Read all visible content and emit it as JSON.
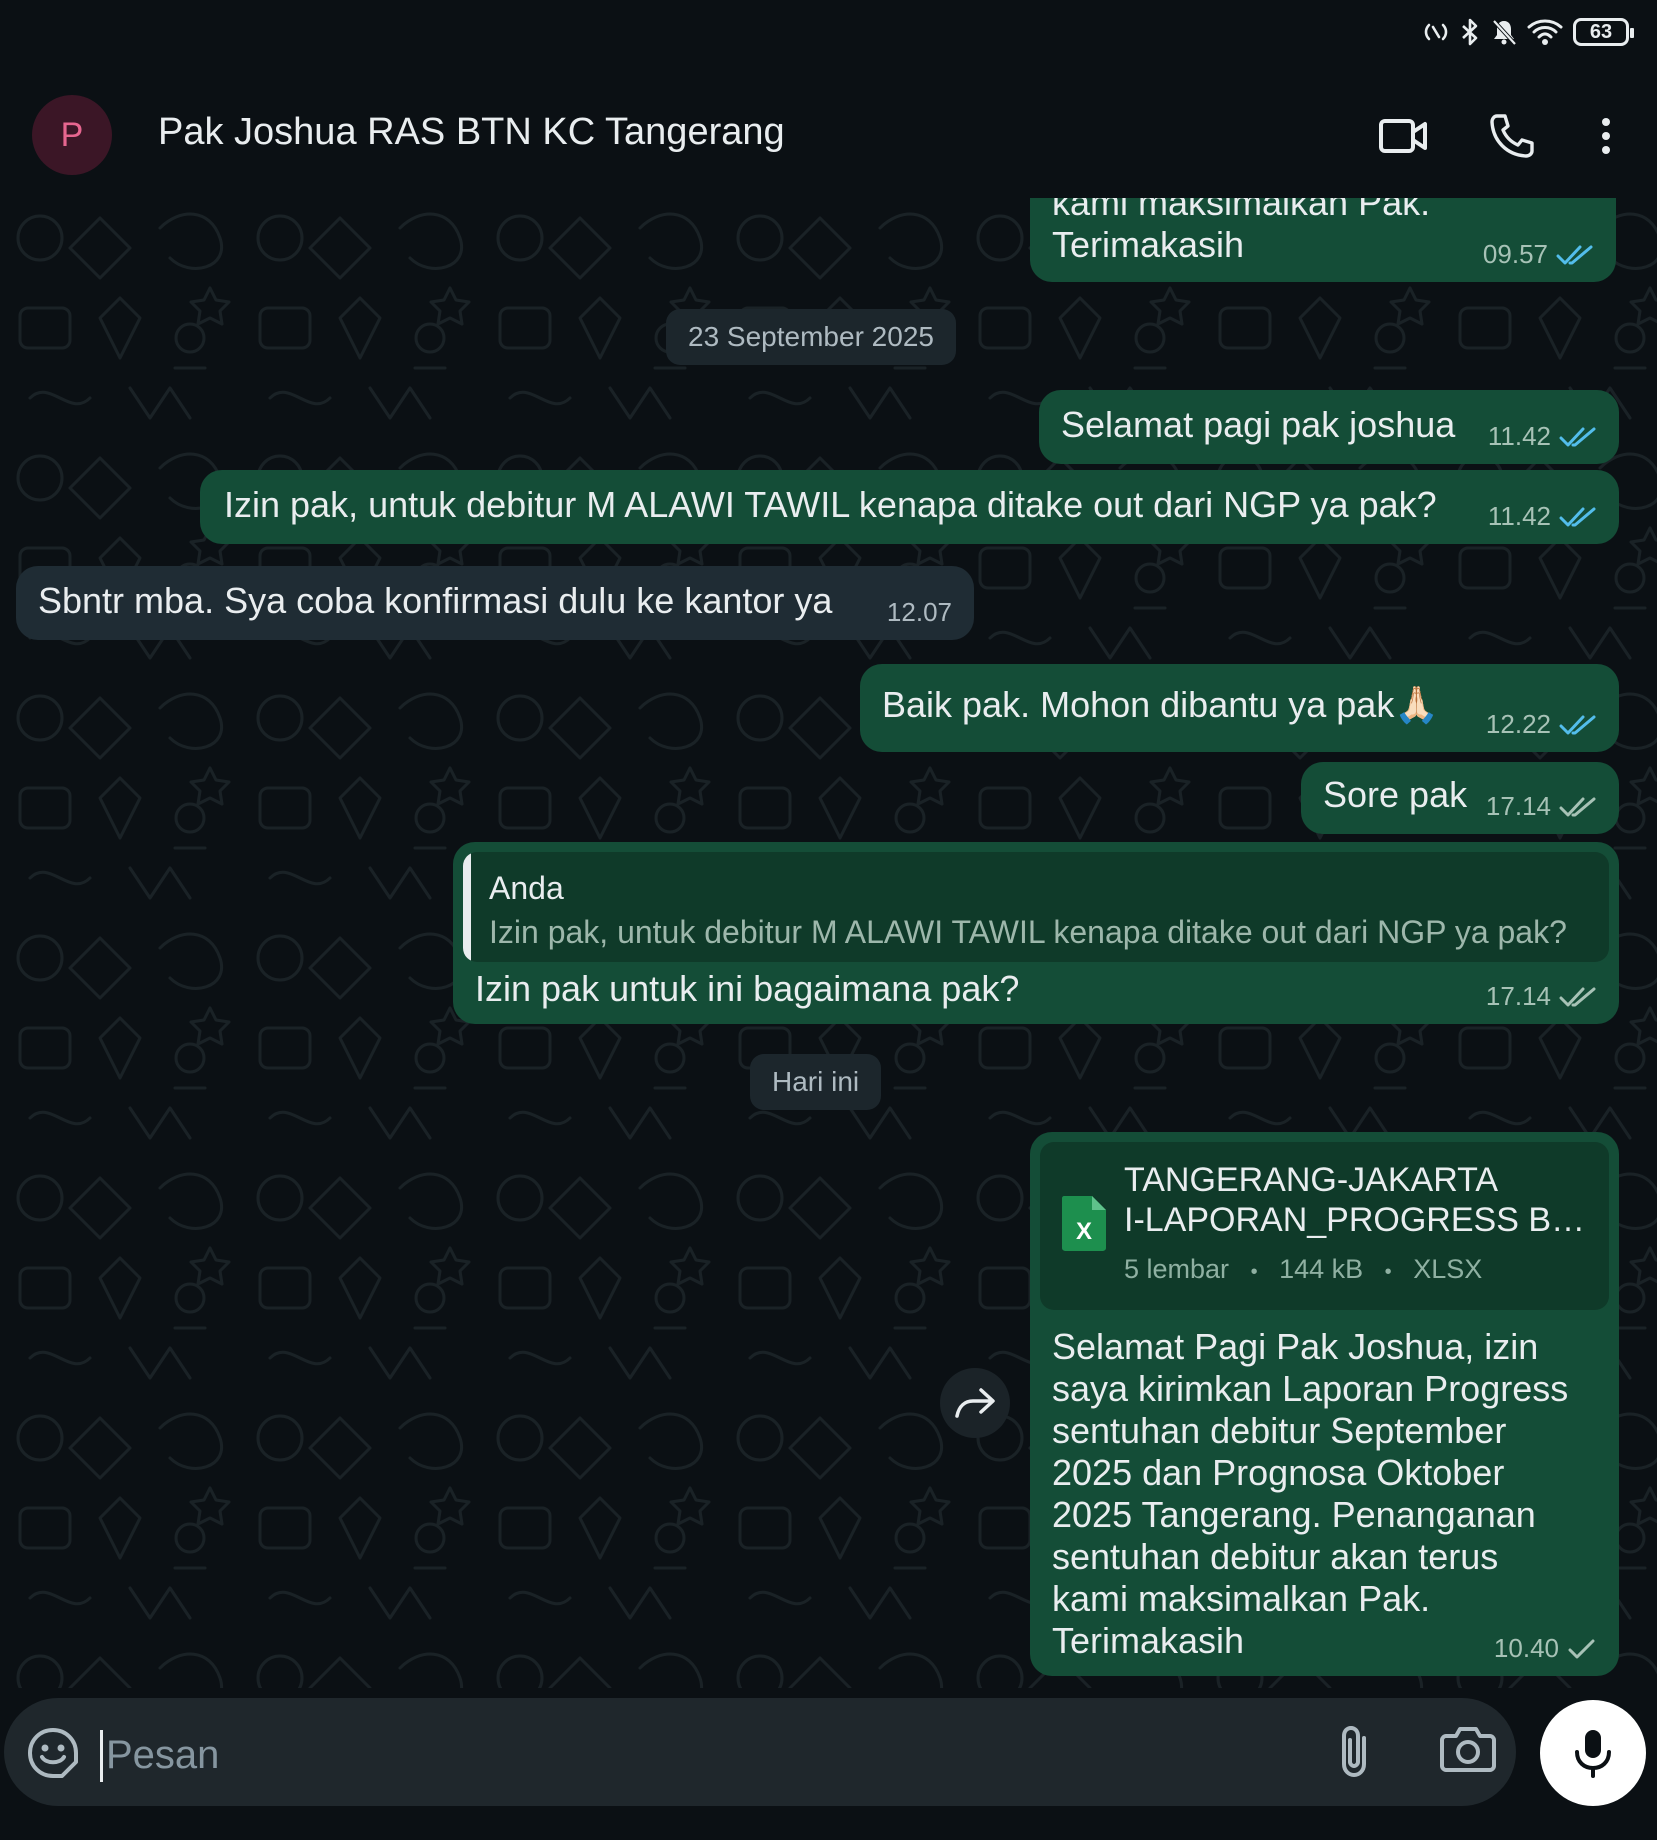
{
  "status_bar": {
    "battery": "63"
  },
  "header": {
    "avatar_letter": "P",
    "contact_name": "Pak Joshua RAS BTN KC Tangerang"
  },
  "messages": [
    {
      "id": "m0",
      "direction": "out",
      "lines": [
        "kami maksimalkan Pak.",
        "Terimakasih"
      ],
      "time": "09.57",
      "status": "read"
    },
    {
      "id": "d1",
      "type": "date",
      "text": "23 September 2025"
    },
    {
      "id": "m1",
      "direction": "out",
      "text": "Selamat pagi pak joshua",
      "time": "11.42",
      "status": "read"
    },
    {
      "id": "m2",
      "direction": "out",
      "text": "Izin pak, untuk debitur M ALAWI TAWIL kenapa ditake out dari NGP ya pak?",
      "time": "11.42",
      "status": "read"
    },
    {
      "id": "m3",
      "direction": "in",
      "text": "Sbntr mba. Sya coba konfirmasi dulu ke kantor ya",
      "time": "12.07"
    },
    {
      "id": "m4",
      "direction": "out",
      "text": "Baik pak. Mohon dibantu ya pak🙏🏻",
      "time": "12.22",
      "status": "read"
    },
    {
      "id": "m5",
      "direction": "out",
      "text": "Sore pak",
      "time": "17.14",
      "status": "delivered"
    },
    {
      "id": "m6",
      "direction": "out",
      "quote": {
        "author": "Anda",
        "text": "Izin pak, untuk debitur M ALAWI TAWIL kenapa ditake out dari NGP ya pak?"
      },
      "text": "Izin pak untuk ini bagaimana pak?",
      "time": "17.14",
      "status": "delivered"
    },
    {
      "id": "d2",
      "type": "date",
      "text": "Hari ini"
    },
    {
      "id": "m7",
      "direction": "out",
      "file": {
        "name_line1": "TANGERANG-JAKARTA",
        "name_line2": "I-LAPORAN_PROGRESS B…",
        "pages": "5 lembar",
        "size": "144 kB",
        "ext": "XLSX",
        "icon_letter": "X"
      },
      "lines": [
        "Selamat Pagi Pak Joshua, izin",
        "saya kirimkan Laporan Progress",
        "sentuhan debitur September",
        "2025 dan Prognosa Oktober",
        "2025 Tangerang. Penanganan",
        "sentuhan debitur akan terus",
        "kami maksimalkan Pak.",
        "Terimakasih"
      ],
      "time": "10.40",
      "status": "sent"
    }
  ],
  "separator": "•",
  "composer": {
    "placeholder": "Pesan",
    "value": ""
  },
  "colors": {
    "background": "#0b1014",
    "outgoing_bubble": "#144d37",
    "incoming_bubble": "#1f2c34",
    "read_ticks": "#53bdeb",
    "avatar_bg": "#3b1626",
    "avatar_fg": "#e6668f",
    "file_icon": "#1d8f4e"
  }
}
